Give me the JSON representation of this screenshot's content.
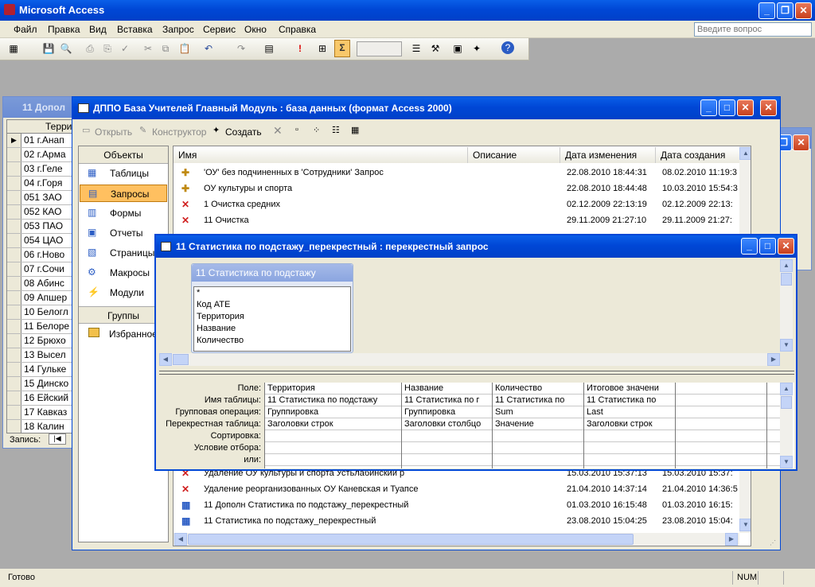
{
  "app": {
    "title": "Microsoft Access",
    "status_left": "Готово",
    "status_num": "NUM"
  },
  "menu": [
    "Файл",
    "Правка",
    "Вид",
    "Вставка",
    "Запрос",
    "Сервис",
    "Окно",
    "Справка"
  ],
  "help": {
    "placeholder": "Введите вопрос"
  },
  "back_window": {
    "title": "11 Допол",
    "records_label": "Запись:",
    "rows": [
      "01 г.Анап",
      "02 г.Арма",
      "03 г.Геле",
      "04 г.Горя",
      "051 ЗАО",
      "052 КАО",
      "053 ПАО",
      "054 ЦАО",
      "06 г.Ново",
      "07 г.Сочи",
      "08 Абинс",
      "09 Апшер",
      "10 Белогл",
      "11 Белоре",
      "12 Брюхо",
      "13 Высел",
      "14 Гулькe",
      "15 Динско",
      "16 Ейский",
      "17 Кавказ",
      "18 Калин"
    ],
    "col": "Терри"
  },
  "db_window": {
    "title": "ДППО База Учителей Главный Модуль  : база данных (формат Access 2000)",
    "toolbar": {
      "open": "Открыть",
      "design": "Конструктор",
      "create": "Создать"
    },
    "objects_header": "Объекты",
    "objects": [
      "Таблицы",
      "Запросы",
      "Формы",
      "Отчеты",
      "Страницы",
      "Макросы",
      "Модули"
    ],
    "groups_header": "Группы",
    "groups": [
      "Избранное"
    ],
    "columns": [
      "Имя",
      "Описание",
      "Дата изменения",
      "Дата создания"
    ],
    "rows_top": [
      {
        "name": "'ОУ' без подчиненных в 'Сотрудники' Запрос",
        "modified": "22.08.2010 18:44:31",
        "created": "08.02.2010 11:19:3"
      },
      {
        "name": "ОУ культуры и спорта",
        "modified": "22.08.2010 18:44:48",
        "created": "10.03.2010 15:54:3"
      },
      {
        "name": "1 Очистка средних",
        "modified": "02.12.2009 22:13:19",
        "created": "02.12.2009 22:13:"
      },
      {
        "name": "11 Очистка",
        "modified": "29.11.2009 21:27:10",
        "created": "29.11.2009 21:27:"
      }
    ],
    "rows_bottom": [
      {
        "name": "Удаление ОУ культуры и спорта Устьлабинский р",
        "modified": "15.03.2010 15:37:13",
        "created": "15.03.2010 15:37:"
      },
      {
        "name": "Удаление реорганизованных ОУ Каневская и Туапсе",
        "modified": "21.04.2010 14:37:14",
        "created": "21.04.2010 14:36:5"
      },
      {
        "name": "11 Дополн Статистика по подстажу_перекрестный",
        "modified": "01.03.2010 16:15:48",
        "created": "01.03.2010 16:15:"
      },
      {
        "name": "11 Статистика по подстажу_перекрестный",
        "modified": "23.08.2010 15:04:25",
        "created": "23.08.2010 15:04:"
      }
    ]
  },
  "query_window": {
    "title": "11 Статистика по подстажу_перекрестный : перекрестный запрос",
    "table_title": "11 Статистика по подстажу",
    "fields": [
      "*",
      "Код АТЕ",
      "Территория",
      "Название",
      "Количество"
    ],
    "row_labels": [
      "Поле:",
      "Имя таблицы:",
      "Групповая операция:",
      "Перекрестная таблица:",
      "Сортировка:",
      "Условие отбора:",
      "или:"
    ],
    "columns": [
      [
        "Территория",
        "11 Статистика по подстажу",
        "Группировка",
        "Заголовки строк",
        "",
        "",
        ""
      ],
      [
        "Название",
        "11 Статистика по г",
        "Группировка",
        "Заголовки столбцо",
        "",
        "",
        ""
      ],
      [
        "Количество",
        "11 Статистика по",
        "Sum",
        "Значение",
        "",
        "",
        ""
      ],
      [
        "Итоговое значени",
        "11 Статистика по",
        "Last",
        "Заголовки строк",
        "",
        "",
        ""
      ],
      [
        "",
        "",
        "",
        "",
        "",
        "",
        ""
      ],
      [
        "",
        "",
        "",
        "",
        "",
        "",
        ""
      ]
    ]
  },
  "colors": {
    "titlebar": "#0047d6",
    "selected": "#ffc060",
    "menubar": "#ece9d8"
  }
}
